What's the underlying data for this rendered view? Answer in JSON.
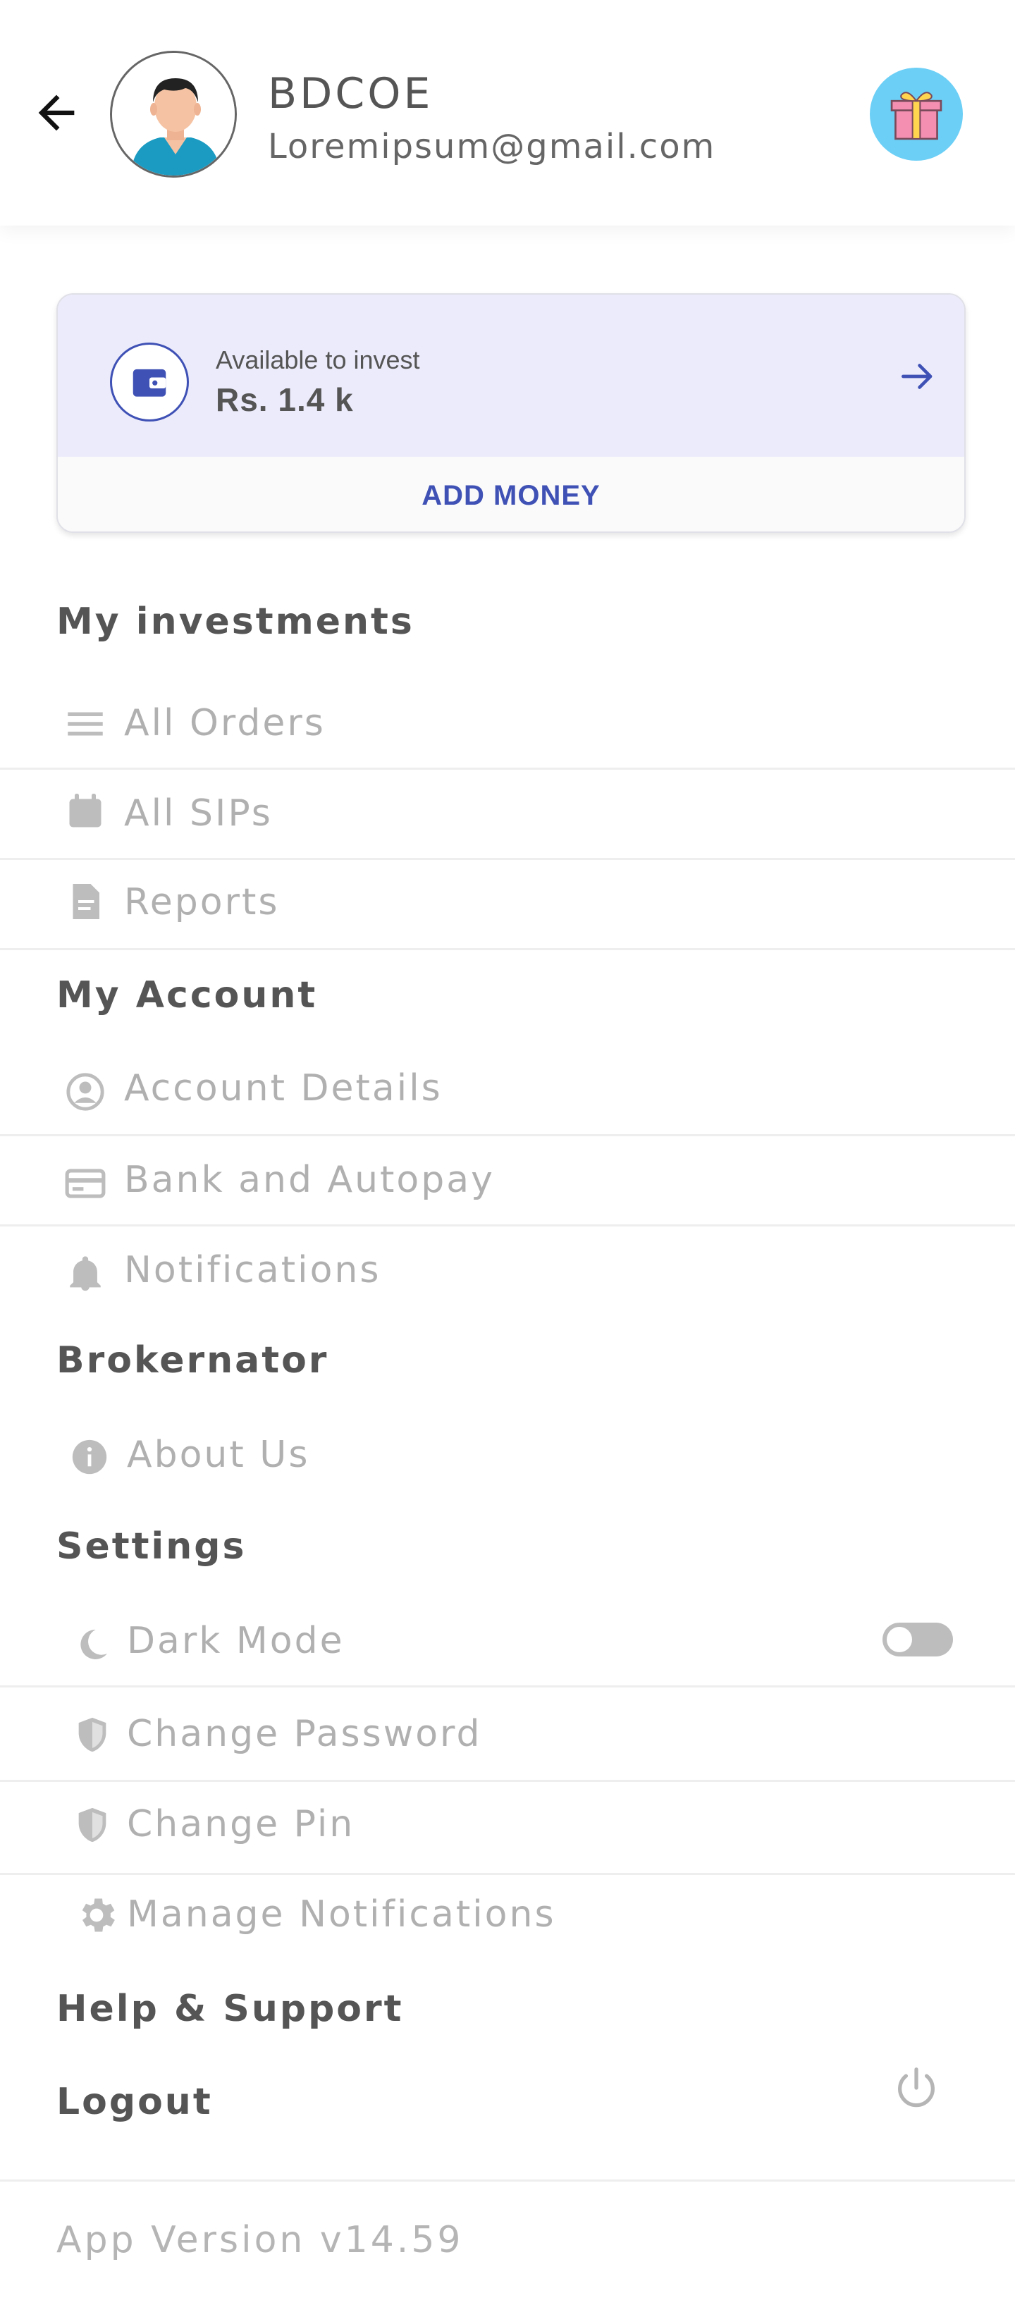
{
  "profile": {
    "name": "BDCOE",
    "email": "Loremipsum@gmail.com"
  },
  "icons": {
    "back": "back-arrow-icon",
    "gift": "gift-icon",
    "wallet": "wallet-icon",
    "forward": "arrow-right-icon",
    "power": "power-icon"
  },
  "wallet": {
    "label": "Available to invest",
    "amount": "Rs. 1.4 k",
    "add_money": "ADD MONEY"
  },
  "sections": {
    "investments": {
      "title": "My investments",
      "items": [
        {
          "label": "All Orders",
          "icon": "list-icon"
        },
        {
          "label": "All SIPs",
          "icon": "calendar-icon"
        },
        {
          "label": "Reports",
          "icon": "document-icon"
        }
      ]
    },
    "account": {
      "title": "My Account",
      "items": [
        {
          "label": "Account Details",
          "icon": "user-circle-icon"
        },
        {
          "label": "Bank and Autopay",
          "icon": "credit-card-icon"
        },
        {
          "label": "Notifications",
          "icon": "bell-icon"
        }
      ]
    },
    "brokernator": {
      "title": "Brokernator",
      "items": [
        {
          "label": "About Us",
          "icon": "info-icon"
        }
      ]
    },
    "settings": {
      "title": "Settings",
      "items": [
        {
          "label": "Dark Mode",
          "icon": "moon-icon",
          "toggle": false
        },
        {
          "label": "Change Password",
          "icon": "shield-icon"
        },
        {
          "label": "Change Pin",
          "icon": "shield-icon"
        },
        {
          "label": "Manage Notifications",
          "icon": "gear-icon"
        }
      ]
    }
  },
  "help": "Help & Support",
  "logout": "Logout",
  "app_version": "App Version v14.59",
  "colors": {
    "accent": "#3f51b5",
    "wallet_bg": "#ebebfb",
    "gift_bg": "#6ccff6",
    "gift_box": "#f48fb1",
    "muted_text": "#b0b0b0",
    "heading_text": "#555555"
  }
}
